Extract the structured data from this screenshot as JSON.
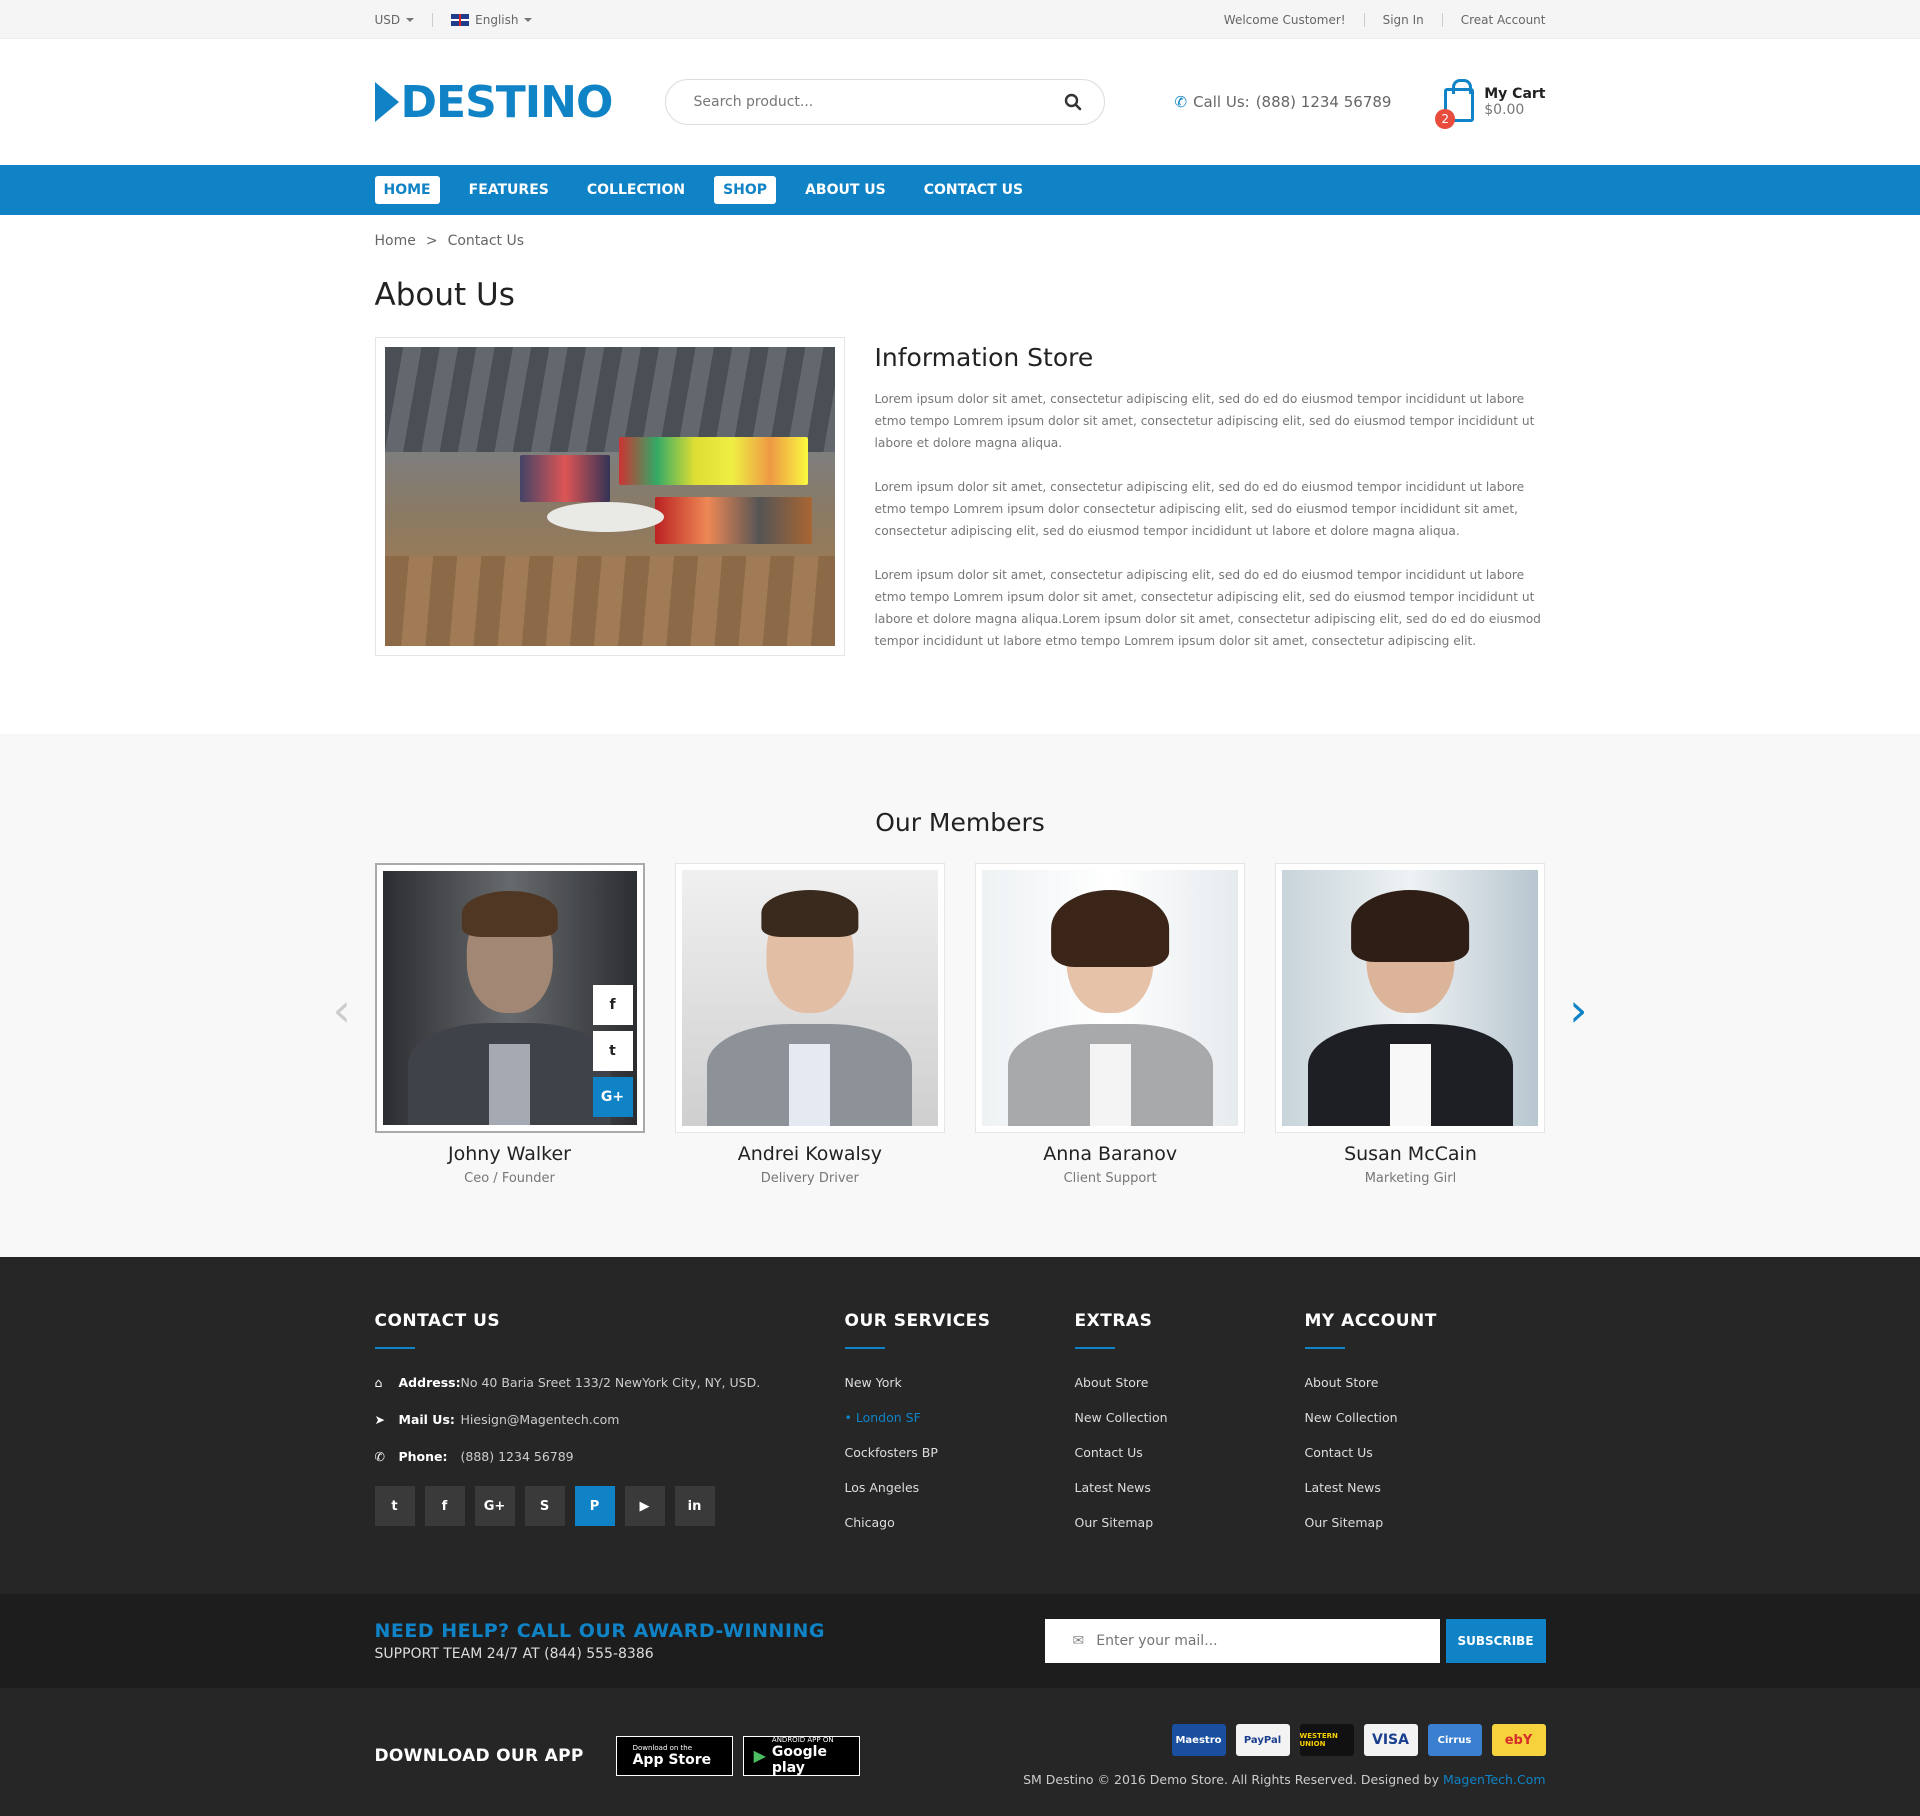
{
  "topbar": {
    "currency": "USD",
    "language": "English",
    "welcome": "Welcome Customer!",
    "sign_in": "Sign In",
    "create_account": "Creat Account"
  },
  "header": {
    "logo": "DESTINO",
    "search_placeholder": "Search product...",
    "phone_label": "Call Us:",
    "phone": "(888) 1234 56789",
    "cart_title": "My Cart",
    "cart_total": "$0.00",
    "cart_count": "2"
  },
  "nav": {
    "items": [
      "HOME",
      "FEATURES",
      "COLLECTION",
      "SHOP",
      "ABOUT US",
      "CONTACT US"
    ]
  },
  "breadcrumb": {
    "home": "Home",
    "sep": ">",
    "current": "Contact Us"
  },
  "page_title": "About Us",
  "info": {
    "title": "Information Store",
    "p1": "Lorem ipsum dolor sit amet, consectetur adipiscing elit, sed do ed do eiusmod tempor incididunt ut labore etmo tempo Lomrem ipsum dolor sit amet, consectetur adipiscing elit, sed do eiusmod tempor incididunt ut labore et dolore magna aliqua.",
    "p2": "Lorem ipsum dolor sit amet, consectetur adipiscing elit, sed do ed do eiusmod tempor incididunt ut labore etmo tempo Lomrem ipsum dolor consectetur adipiscing elit, sed do eiusmod tempor incididunt sit amet, consectetur adipiscing elit, sed do eiusmod tempor incididunt ut labore et dolore magna aliqua.",
    "p3": "Lorem ipsum dolor sit amet, consectetur adipiscing elit, sed do ed do eiusmod tempor incididunt ut labore etmo tempo Lomrem ipsum dolor sit amet, consectetur adipiscing elit, sed do eiusmod tempor incididunt ut labore et dolore magna aliqua.Lorem ipsum dolor sit amet, consectetur adipiscing elit, sed do ed do eiusmod tempor incididunt ut labore etmo tempo Lomrem ipsum dolor sit amet, consectetur adipiscing elit."
  },
  "members": {
    "title": "Our Members",
    "list": [
      {
        "name": "Johny Walker",
        "role": "Ceo / Founder"
      },
      {
        "name": "Andrei Kowalsy",
        "role": "Delivery Driver"
      },
      {
        "name": "Anna Baranov",
        "role": "Client Support"
      },
      {
        "name": "Susan McCain",
        "role": "Marketing Girl"
      }
    ]
  },
  "footer": {
    "contact": {
      "title": "CONTACT US",
      "address_label": "Address:",
      "address": "No 40 Baria Sreet 133/2 NewYork City, NY, USD.",
      "mail_label": "Mail Us:",
      "mail": "Hiesign@Magentech.com",
      "phone_label": "Phone:",
      "phone": "(888) 1234 56789"
    },
    "services": {
      "title": "OUR SERVICES",
      "items": [
        "New York",
        "London SF",
        "Cockfosters BP",
        "Los Angeles",
        "Chicago"
      ]
    },
    "extras": {
      "title": "EXTRAS",
      "items": [
        "About Store",
        "New Collection",
        "Contact Us",
        "Latest News",
        "Our Sitemap"
      ]
    },
    "account": {
      "title": "MY ACCOUNT",
      "items": [
        "About Store",
        "New Collection",
        "Contact Us",
        "Latest News",
        "Our Sitemap"
      ]
    }
  },
  "help": {
    "line1": "NEED HELP? CALL OUR AWARD-WINNING",
    "line2": "SUPPORT TEAM 24/7 AT (844) 555-8386",
    "placeholder": "Enter your mail...",
    "button": "SUBSCRIBE"
  },
  "bottom": {
    "download": "DOWNLOAD OUR APP",
    "appstore_small": "Download on the",
    "appstore_big": "App Store",
    "gplay_small": "ANDROID APP ON",
    "gplay_big": "Google play",
    "payments": [
      "Maestro",
      "PayPal",
      "WESTERN UNION",
      "VISA",
      "Cirrus",
      "ebY"
    ],
    "copyright": "SM Destino © 2016 Demo Store. All Rights Reserved. Designed by",
    "designer": "MagenTech.Com"
  },
  "colors": {
    "primary": "#0f83c6",
    "footer_bg": "#262626"
  }
}
